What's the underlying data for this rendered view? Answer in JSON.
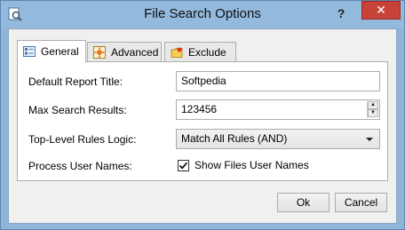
{
  "window": {
    "title": "File Search Options",
    "help_label": "?",
    "close_label": "✕"
  },
  "tabs": [
    {
      "label": "General",
      "icon": "general-icon",
      "active": true
    },
    {
      "label": "Advanced",
      "icon": "advanced-icon",
      "active": false
    },
    {
      "label": "Exclude",
      "icon": "exclude-icon",
      "active": false
    }
  ],
  "form": {
    "report_title_label": "Default Report Title:",
    "report_title_value": "Softpedia",
    "max_results_label": "Max Search Results:",
    "max_results_value": "123456",
    "rules_logic_label": "Top-Level Rules Logic:",
    "rules_logic_value": "Match All Rules (AND)",
    "process_users_label": "Process User Names:",
    "show_users_label": "Show Files User Names",
    "show_users_checked": true
  },
  "buttons": {
    "ok": "Ok",
    "cancel": "Cancel"
  },
  "colors": {
    "titlebar": "#93b9dd",
    "close": "#c7433a"
  }
}
